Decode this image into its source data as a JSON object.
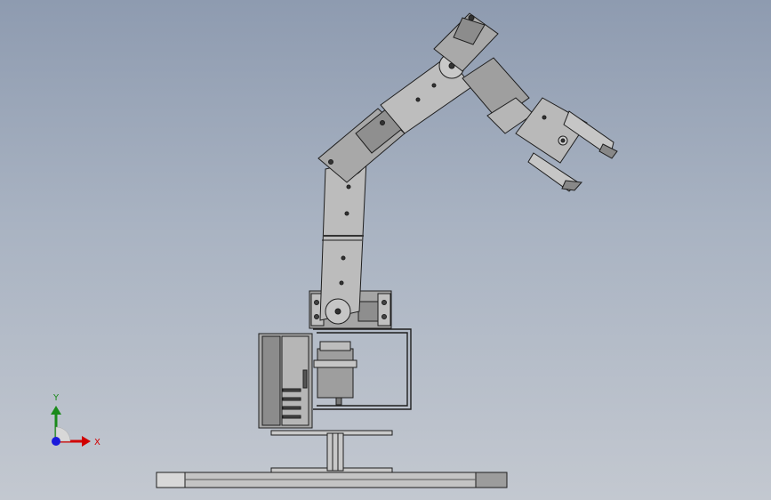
{
  "viewport": {
    "background_top": "#8e9bb0",
    "background_bottom": "#c3c8d0",
    "model": "robot-arm-assembly",
    "view": "front"
  },
  "triad": {
    "x_label": "X",
    "y_label": "Y",
    "x_color": "#d10000",
    "y_color": "#1a8a1a",
    "z_color": "#1a1adb"
  },
  "colors": {
    "part_fill": "#b8b8b8",
    "part_dark": "#8a8a8a",
    "edge": "#1e1e1e"
  }
}
